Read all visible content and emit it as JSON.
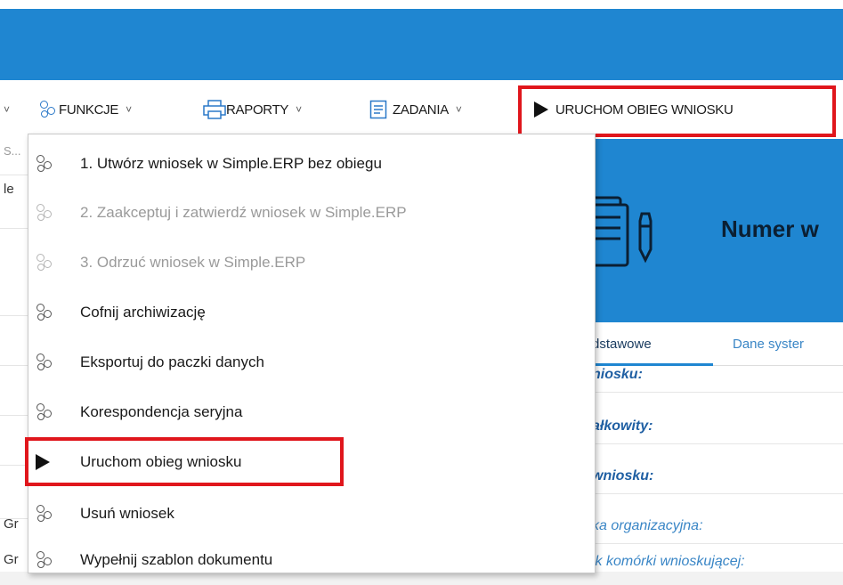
{
  "toolbar": {
    "funkcje": "FUNKCJE",
    "raporty": "RAPORTY",
    "zadania": "ZADANIA",
    "uruchom": "URUCHOM OBIEG WNIOSKU"
  },
  "left_fragments": [
    "S...",
    "le",
    "Gr",
    "Gr"
  ],
  "menu": {
    "items": [
      {
        "label": "1. Utwórz wniosek w Simple.ERP bez obiegu",
        "icon": "cogs-icon",
        "enabled": true
      },
      {
        "label": "2. Zaakceptuj i zatwierdź wniosek w Simple.ERP",
        "icon": "cogs-icon",
        "enabled": false
      },
      {
        "label": "3. Odrzuć wniosek w Simple.ERP",
        "icon": "cogs-icon",
        "enabled": false
      },
      {
        "label": "Cofnij archiwizację",
        "icon": "cogs-icon",
        "enabled": true
      },
      {
        "label": "Eksportuj do paczki danych",
        "icon": "cogs-icon",
        "enabled": true
      },
      {
        "label": "Korespondencja seryjna",
        "icon": "cogs-icon",
        "enabled": true
      },
      {
        "label": "Uruchom obieg wniosku",
        "icon": "play-icon",
        "enabled": true
      },
      {
        "label": "Usuń wniosek",
        "icon": "cogs-icon",
        "enabled": true
      },
      {
        "label": "Wypełnij szablon dokumentu",
        "icon": "cogs-icon",
        "enabled": true
      }
    ]
  },
  "panel": {
    "title": "Numer w",
    "tabs": [
      "dstawowe",
      "Dane syster"
    ],
    "fields": [
      "niosku:",
      "ałkowity:",
      "wniosku:",
      "ka organizacyjna:",
      "ik komórki wnioskującej:"
    ]
  },
  "colors": {
    "header_blue": "#1f86d1",
    "highlight_red": "#e0161c"
  }
}
